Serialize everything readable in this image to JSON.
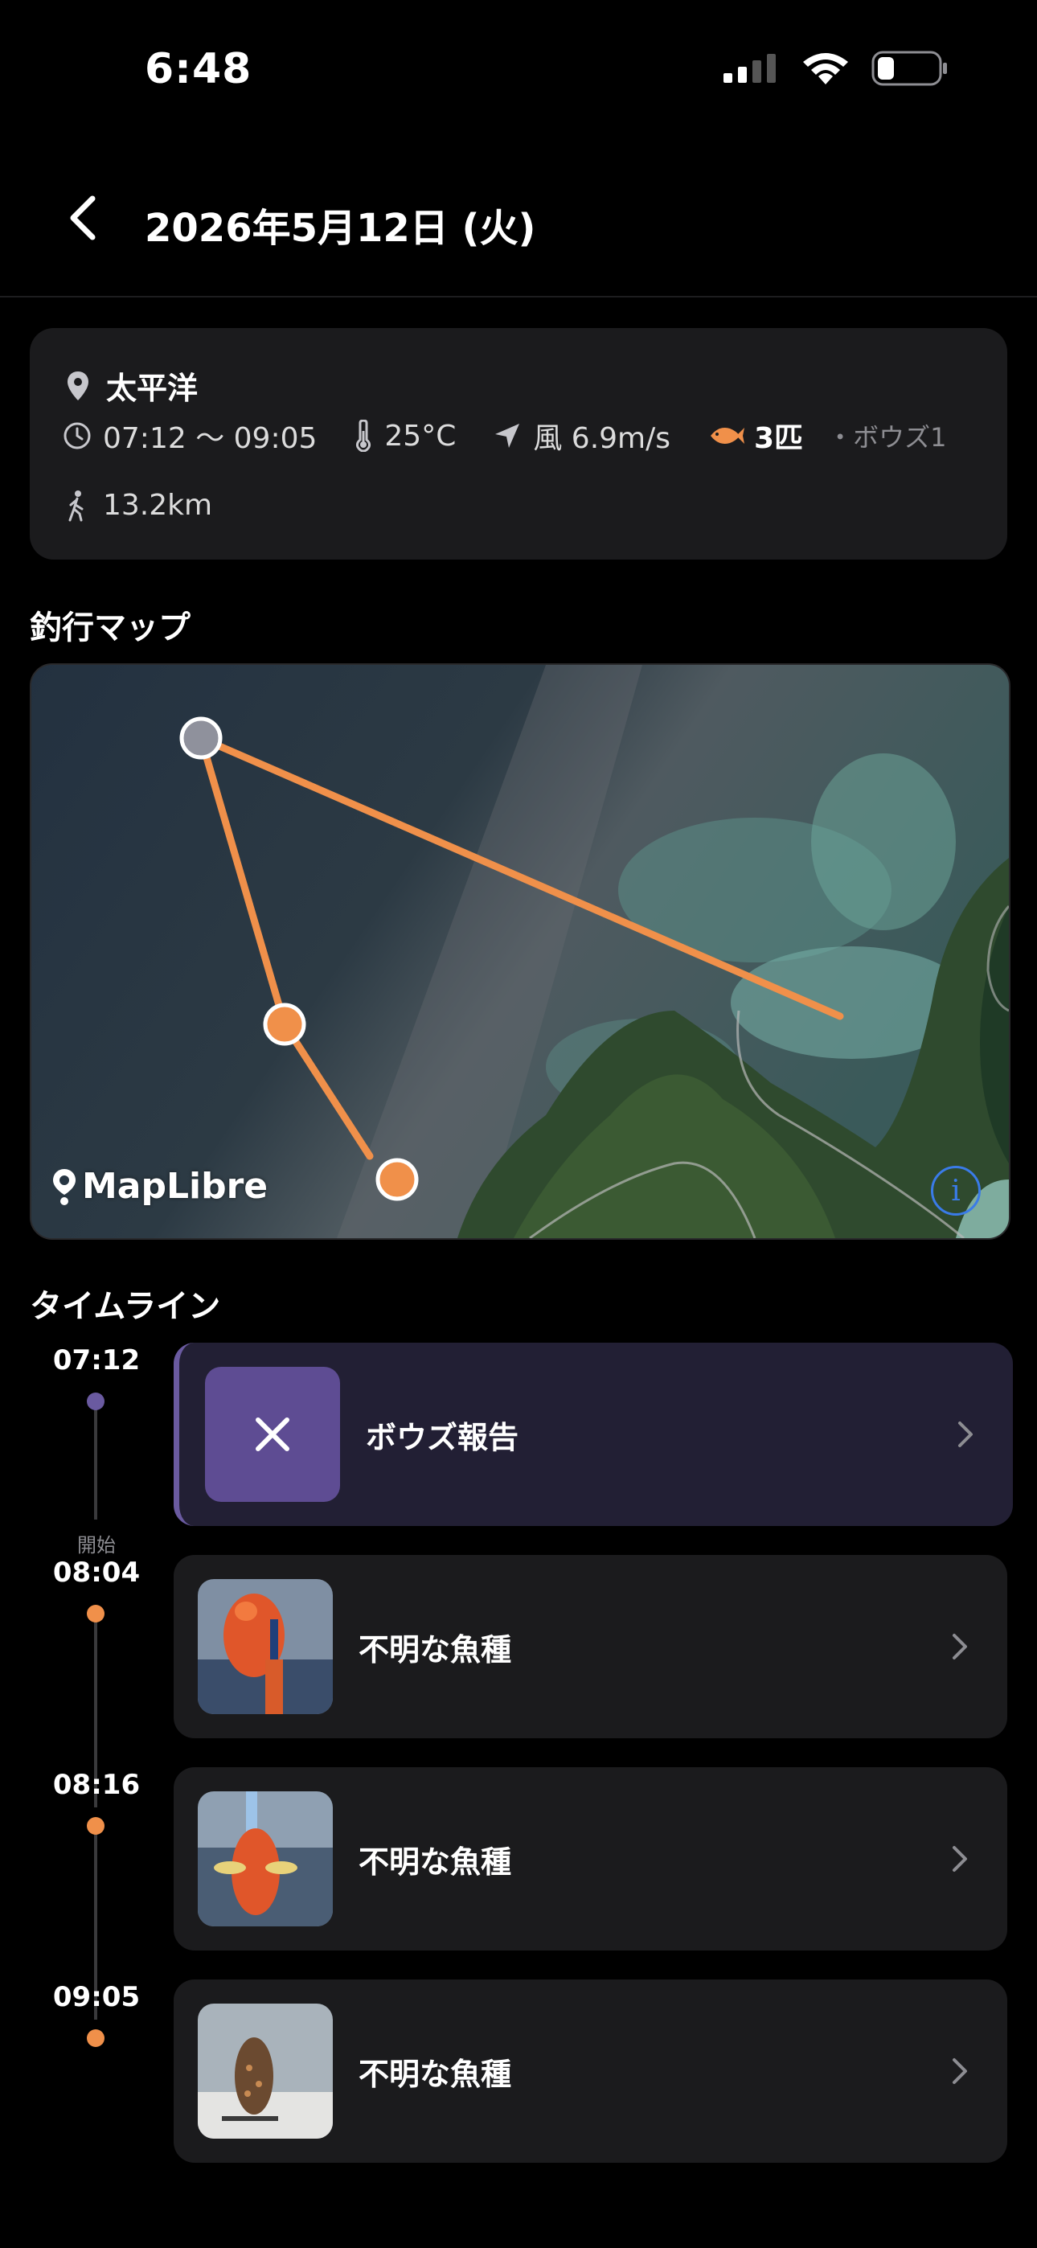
{
  "status_bar": {
    "time": "6:48"
  },
  "header": {
    "title": "2026年5月12日 (火)"
  },
  "summary": {
    "location": "太平洋",
    "time_range": "07:12 〜 09:05",
    "temperature": "25°C",
    "wind": "風 6.9m/s",
    "catch_count": "3匹",
    "bouzu": "・ボウズ1",
    "distance": "13.2km"
  },
  "map_section": {
    "title": "釣行マップ",
    "attribution": "MapLibre",
    "info_label": "i"
  },
  "timeline": {
    "title": "タイムライン",
    "entries": [
      {
        "time": "07:12",
        "sub": "",
        "label": "ボウズ報告",
        "kind": "bouzu"
      },
      {
        "time": "08:04",
        "sub": "開始",
        "label": "不明な魚種",
        "kind": "catch"
      },
      {
        "time": "08:16",
        "sub": "",
        "label": "不明な魚種",
        "kind": "catch"
      },
      {
        "time": "09:05",
        "sub": "",
        "label": "不明な魚種",
        "kind": "catch"
      }
    ]
  },
  "colors": {
    "accent": "#f0904a",
    "bouzu": "#6a5aa0",
    "card": "#1b1b1d"
  }
}
